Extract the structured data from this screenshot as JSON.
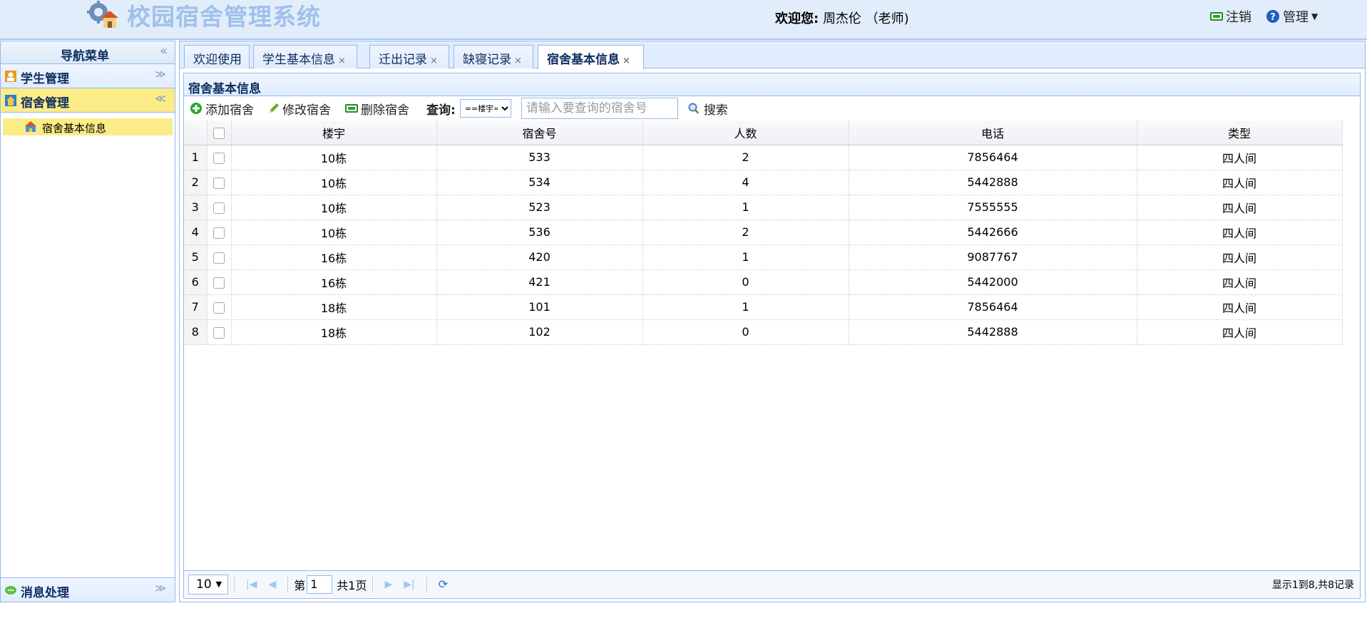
{
  "header": {
    "title": "校园宿舍管理系统",
    "welcome_label": "欢迎您:",
    "user": "周杰伦 （老师)",
    "logout_label": "注销",
    "manage_label": "管理"
  },
  "sidebar": {
    "title": "导航菜单",
    "groups": [
      {
        "label": "学生管理"
      },
      {
        "label": "宿舍管理"
      },
      {
        "label": "消息处理"
      }
    ],
    "sub_item": "宿舍基本信息"
  },
  "tabs": [
    {
      "label": "欢迎使用"
    },
    {
      "label": "学生基本信息"
    },
    {
      "label": "迁出记录"
    },
    {
      "label": "缺寝记录"
    },
    {
      "label": "宿舍基本信息"
    }
  ],
  "panel": {
    "title": "宿舍基本信息",
    "add_label": "添加宿舍",
    "edit_label": "修改宿舍",
    "delete_label": "删除宿舍",
    "query_label": "查询:",
    "select_value": "==楼宇==",
    "search_placeholder": "请输入要查询的宿舍号",
    "search_label": "搜索"
  },
  "table": {
    "columns": [
      "楼宇",
      "宿舍号",
      "人数",
      "电话",
      "类型"
    ],
    "rows": [
      {
        "num": "1",
        "building": "10栋",
        "room": "533",
        "count": "2",
        "phone": "7856464",
        "type": "四人间"
      },
      {
        "num": "2",
        "building": "10栋",
        "room": "534",
        "count": "4",
        "phone": "5442888",
        "type": "四人间"
      },
      {
        "num": "3",
        "building": "10栋",
        "room": "523",
        "count": "1",
        "phone": "7555555",
        "type": "四人间"
      },
      {
        "num": "4",
        "building": "10栋",
        "room": "536",
        "count": "2",
        "phone": "5442666",
        "type": "四人间"
      },
      {
        "num": "5",
        "building": "16栋",
        "room": "420",
        "count": "1",
        "phone": "9087767",
        "type": "四人间"
      },
      {
        "num": "6",
        "building": "16栋",
        "room": "421",
        "count": "0",
        "phone": "5442000",
        "type": "四人间"
      },
      {
        "num": "7",
        "building": "18栋",
        "room": "101",
        "count": "1",
        "phone": "7856464",
        "type": "四人间"
      },
      {
        "num": "8",
        "building": "18栋",
        "room": "102",
        "count": "0",
        "phone": "5442888",
        "type": "四人间"
      }
    ]
  },
  "pager": {
    "page_size": "10",
    "page_prefix": "第",
    "page_value": "1",
    "total_pages": "共1页",
    "info": "显示1到8,共8记录"
  },
  "colors": {
    "header_bg": "#e2edfb",
    "title_color": "#9fc0ea",
    "border": "#95b8e7",
    "active_item": "#fbec88"
  },
  "icons": {
    "logo": "house-gear-icon",
    "logout": "logout-icon",
    "help": "help-icon",
    "add": "add-icon",
    "edit": "pencil-icon",
    "delete": "delete-icon",
    "search": "search-icon"
  }
}
